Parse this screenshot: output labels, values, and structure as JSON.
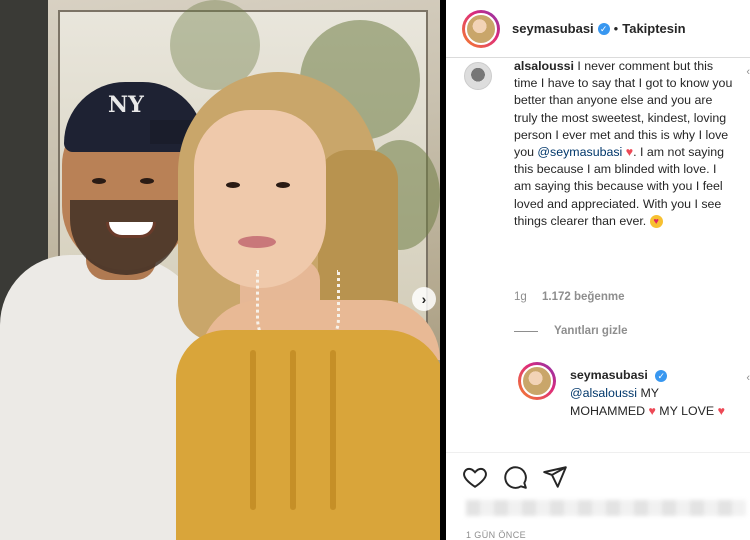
{
  "post": {
    "author": "seymasubasi",
    "verified_mark": "✓",
    "follow_status": "Takiptesin",
    "dot": "•",
    "photo_next": "›"
  },
  "comment": {
    "username": "alsaloussi",
    "text_part1": "I never comment but this time I have to say that I got to know you better than anyone else and you are truly the most sweetest, kindest, loving person I ever met and this is why I love you ",
    "mention": "@seymasubasi",
    "heart": "♥",
    "text_part2": ". I am not saying this because I am blinded with love. I am saying this because with you I feel loved and appreciated. With you I see things clearer than ever. ",
    "emoji": "♥",
    "time": "1g",
    "likes": "1.172 beğenme",
    "hide_replies": "Yanıtları gizle"
  },
  "reply": {
    "username": "seymasubasi",
    "verified_mark": "✓",
    "mention": "@alsaloussi",
    "text1": " MY MOHAMMED ",
    "heart1": "♥",
    "text2": " MY LOVE ",
    "heart2": "♥"
  },
  "actions": {
    "like_icon": "heart-outline-icon",
    "comment_icon": "comment-bubble-icon",
    "share_icon": "paper-plane-icon"
  },
  "footer": {
    "timestamp": "1 GÜN ÖNCE"
  },
  "colors": {
    "mention": "#00376b",
    "heart": "#ed4956",
    "verified": "#3897f0",
    "muted": "#8e8e8e"
  }
}
